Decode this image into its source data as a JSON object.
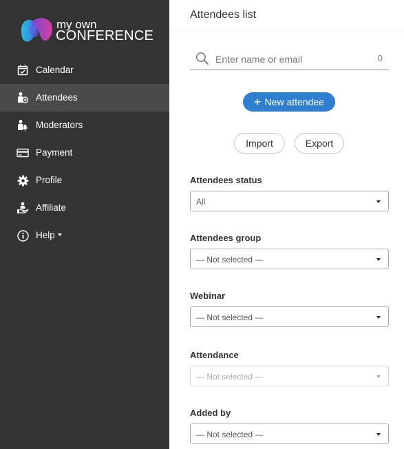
{
  "brand": {
    "line1": "my own",
    "line2": "CONFERENCE"
  },
  "sidebar": {
    "items": [
      {
        "label": "Calendar",
        "icon": "calendar-icon"
      },
      {
        "label": "Attendees",
        "icon": "attendees-icon",
        "active": true
      },
      {
        "label": "Moderators",
        "icon": "moderators-icon"
      },
      {
        "label": "Payment",
        "icon": "credit-card-icon"
      },
      {
        "label": "Profile",
        "icon": "gear-icon"
      },
      {
        "label": "Affiliate",
        "icon": "affiliate-icon"
      },
      {
        "label": "Help",
        "icon": "info-icon",
        "dropdown": true
      }
    ]
  },
  "main": {
    "title": "Attendees list",
    "search": {
      "placeholder": "Enter name or email",
      "count": "0"
    },
    "new_button": "New attendee",
    "import_button": "Import",
    "export_button": "Export",
    "filters": [
      {
        "label": "Attendees status",
        "value": "All",
        "disabled": false
      },
      {
        "label": "Attendees group",
        "value": "— Not selected —",
        "disabled": false
      },
      {
        "label": "Webinar",
        "value": "— Not selected —",
        "disabled": false
      },
      {
        "label": "Attendance",
        "value": "— Not selected —",
        "disabled": true
      },
      {
        "label": "Added by",
        "value": "— Not selected —",
        "disabled": false
      }
    ]
  },
  "colors": {
    "sidebar_bg": "#333333",
    "sidebar_active": "#4a4a4a",
    "accent": "#2f7fd1"
  }
}
